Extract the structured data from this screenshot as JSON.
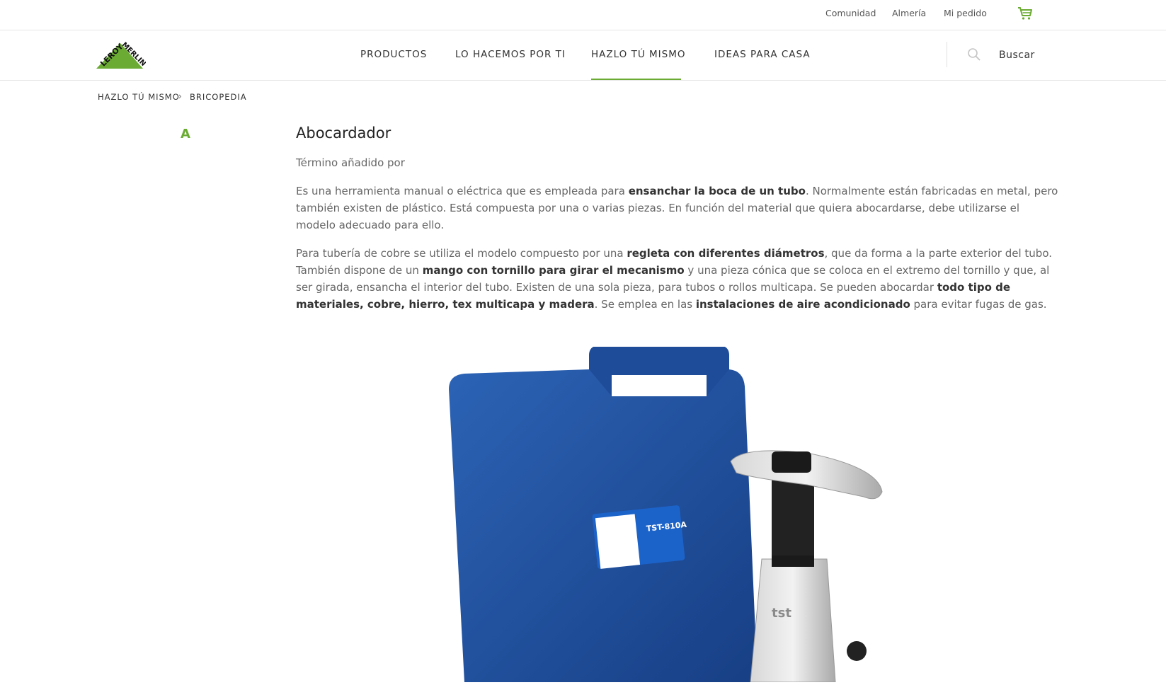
{
  "topbar": {
    "comunidad": "Comunidad",
    "store": "Almería",
    "order": "Mi pedido"
  },
  "logo": {
    "text_1": "LEROY",
    "text_2": "MERLIN"
  },
  "nav": {
    "items": [
      {
        "label": "PRODUCTOS"
      },
      {
        "label": "LO HACEMOS POR TI"
      },
      {
        "label": "HAZLO TÚ MISMO"
      },
      {
        "label": "IDEAS PARA CASA"
      }
    ],
    "search_label": "Buscar"
  },
  "breadcrumb": [
    "HAZLO TÚ MISMO",
    "BRICOPEDIA"
  ],
  "sidebar": {
    "letter": "A"
  },
  "article": {
    "title": "Abocardador",
    "author_line": "Término añadido por",
    "p1": {
      "t1": "Es una herramienta manual o eléctrica que es empleada para ",
      "b1": "ensanchar la boca de un tubo",
      "t2": ". Normalmente están fabricadas en metal, pero también existen de plástico. Está compuesta por una o varias piezas. En función del material que quiera abocardarse, debe utilizarse el modelo adecuado para ello."
    },
    "p2": {
      "t1": "Para tubería de cobre se utiliza el modelo compuesto por una ",
      "b1": "regleta con diferentes diámetros",
      "t2": ", que da forma a la parte exterior del tubo. También dispone de un ",
      "b2": "mango con tornillo para girar el mecanismo",
      "t3": " y una pieza cónica que se coloca en el extremo del tornillo y que, al ser girada, ensancha el interior del tubo. Existen de una sola pieza, para tubos o rollos multicapa. Se pueden abocardar ",
      "b3": "todo tipo de materiales, cobre, hierro, tex multicapa y madera",
      "t4": ". Se emplea en las ",
      "b4": "instalaciones de aire acondicionado",
      "t5": " para evitar fugas de gas."
    },
    "image": {
      "label_text": "TST-810A",
      "brand_text": "tst"
    }
  },
  "colors": {
    "accent": "#6bab33",
    "case_blue": "#1d4f9c"
  }
}
